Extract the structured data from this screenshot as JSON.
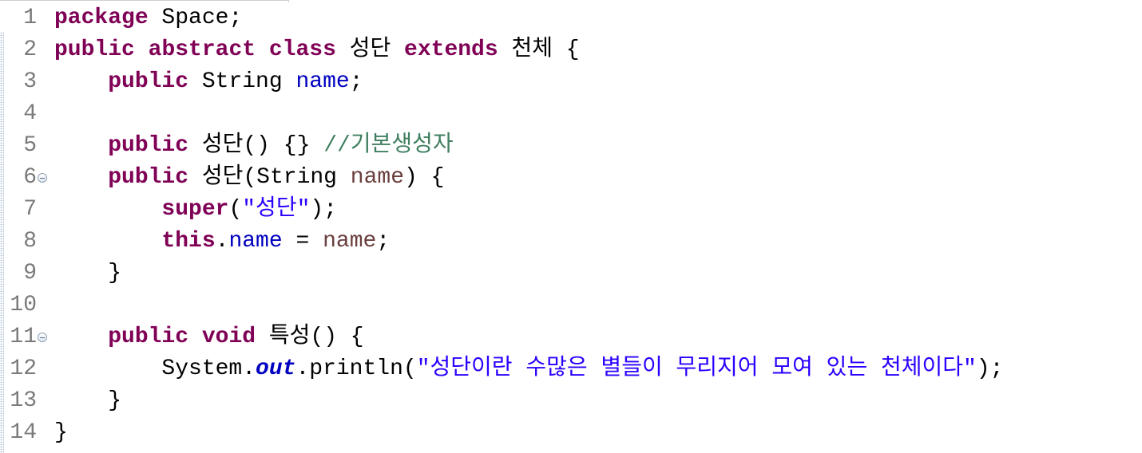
{
  "editor": {
    "line_numbers": [
      "1",
      "2",
      "3",
      "4",
      "5",
      "6",
      "7",
      "8",
      "9",
      "10",
      "11",
      "12",
      "13",
      "14"
    ],
    "folds": [
      "collapse",
      "collapse"
    ],
    "lines": [
      {
        "text_kw": "package",
        "text_rest": " Space;"
      },
      {
        "a": "public",
        "b": " ",
        "c": "abstract",
        "d": " ",
        "e": "class",
        "f": " 성단 ",
        "g": "extends",
        "h": " 천체 {"
      },
      {
        "indent": "    ",
        "kw": "public",
        "rest": " String ",
        "field": "name",
        "end": ";"
      },
      {},
      {
        "indent": "    ",
        "kw": "public",
        "rest": " 성단() {} ",
        "comment": "//기본생성자"
      },
      {
        "indent": "    ",
        "kw": "public",
        "rest": " 성단(String ",
        "param": "name",
        "end": ") {"
      },
      {
        "indent": "        ",
        "kw": "super",
        "open": "(",
        "string": "\"성단\"",
        "end": ");"
      },
      {
        "indent": "        ",
        "kw": "this",
        "dot": ".",
        "field": "name",
        "mid": " = ",
        "param": "name",
        "end": ";"
      },
      {
        "indent": "    ",
        "rest": "}"
      },
      {},
      {
        "indent": "    ",
        "kw1": "public",
        "sp": " ",
        "kw2": "void",
        "rest": " 특성() {"
      },
      {
        "indent": "        ",
        "pre": "System.",
        "static": "out",
        "mid": ".println(",
        "string": "\"성단이란 수많은 별들이 무리지어 모여 있는 천체이다\"",
        "end": ");"
      },
      {
        "indent": "    ",
        "rest": "}"
      },
      {
        "rest": "}"
      }
    ]
  },
  "colors": {
    "keyword": "#7f0055",
    "field": "#0000c0",
    "parameter": "#6a3e3e",
    "string": "#2a00ff",
    "comment": "#3f7f5f",
    "line_number": "#7a7a7a"
  }
}
